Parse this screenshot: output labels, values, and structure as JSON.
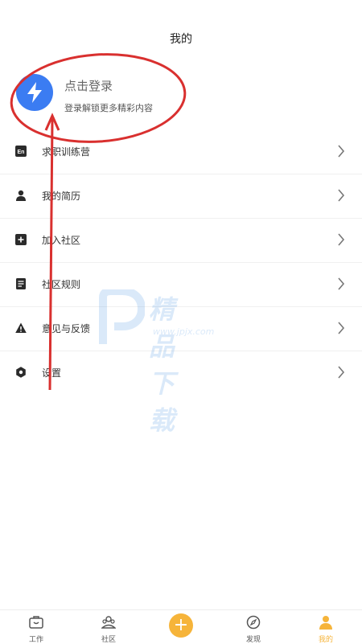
{
  "header": {
    "title": "我的"
  },
  "login": {
    "title": "点击登录",
    "subtitle": "登录解锁更多精彩内容"
  },
  "menu": {
    "items": [
      {
        "label": "求职训练营",
        "icon": "en-badge-icon"
      },
      {
        "label": "我的简历",
        "icon": "person-icon"
      },
      {
        "label": "加入社区",
        "icon": "plus-square-icon"
      },
      {
        "label": "社区规则",
        "icon": "document-icon"
      },
      {
        "label": "意见与反馈",
        "icon": "warning-icon"
      },
      {
        "label": "设置",
        "icon": "settings-hexagon-icon"
      }
    ]
  },
  "watermark": {
    "title": "精品下载",
    "url": "www.jpjx.com"
  },
  "tabbar": {
    "items": [
      {
        "label": "工作",
        "icon": "briefcase-icon"
      },
      {
        "label": "社区",
        "icon": "community-icon"
      },
      {
        "label": "",
        "icon": "plus-icon"
      },
      {
        "label": "发现",
        "icon": "compass-icon"
      },
      {
        "label": "我的",
        "icon": "user-icon",
        "active": true
      }
    ]
  },
  "colors": {
    "accent": "#f6b43a",
    "avatar": "#3b7cf2",
    "annotation": "#d9302f"
  }
}
